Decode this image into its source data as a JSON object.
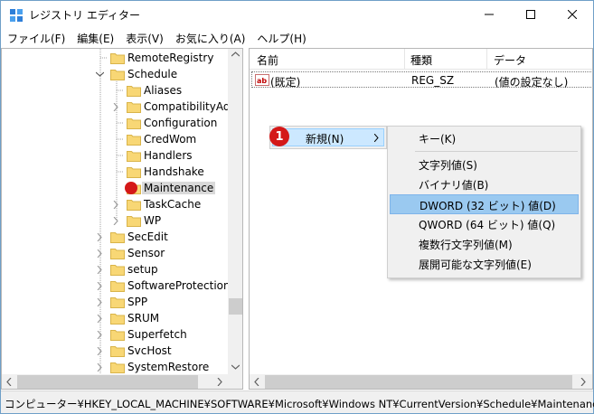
{
  "window": {
    "title": "レジストリ エディター",
    "minimize_icon": "minimize-icon",
    "maximize_icon": "maximize-icon",
    "close_icon": "close-icon"
  },
  "menubar": [
    "ファイル(F)",
    "編集(E)",
    "表示(V)",
    "お気に入り(A)",
    "ヘルプ(H)"
  ],
  "tree": {
    "items": [
      {
        "label": "RemoteRegistry",
        "expander": ""
      },
      {
        "label": "Schedule",
        "expander": "expanded"
      },
      {
        "label": "Aliases",
        "expander": ""
      },
      {
        "label": "CompatibilityAda",
        "expander": "collapsed"
      },
      {
        "label": "Configuration",
        "expander": ""
      },
      {
        "label": "CredWom",
        "expander": ""
      },
      {
        "label": "Handlers",
        "expander": ""
      },
      {
        "label": "Handshake",
        "expander": ""
      },
      {
        "label": "Maintenance",
        "expander": "",
        "selected": true
      },
      {
        "label": "TaskCache",
        "expander": "collapsed"
      },
      {
        "label": "WP",
        "expander": "collapsed"
      },
      {
        "label": "SecEdit",
        "expander": "collapsed"
      },
      {
        "label": "Sensor",
        "expander": "collapsed"
      },
      {
        "label": "setup",
        "expander": "collapsed"
      },
      {
        "label": "SoftwareProtectionPl",
        "expander": "collapsed"
      },
      {
        "label": "SPP",
        "expander": "collapsed"
      },
      {
        "label": "SRUM",
        "expander": "collapsed"
      },
      {
        "label": "Superfetch",
        "expander": "collapsed"
      },
      {
        "label": "SvcHost",
        "expander": "collapsed"
      },
      {
        "label": "SystemRestore",
        "expander": "collapsed"
      }
    ]
  },
  "list": {
    "columns": [
      "名前",
      "種類",
      "データ"
    ],
    "rows": [
      {
        "name": "(既定)",
        "type": "REG_SZ",
        "data": "(値の設定なし)",
        "icon": "string-value-icon"
      }
    ]
  },
  "context_menu": {
    "parent_label": "新規(N)",
    "step_badge": "1",
    "items": [
      "キー(K)",
      "文字列値(S)",
      "バイナリ値(B)",
      "DWORD (32 ビット) 値(D)",
      "QWORD (64 ビット) 値(Q)",
      "複数行文字列値(M)",
      "展開可能な文字列値(E)"
    ],
    "highlighted_index": 3
  },
  "status": {
    "path": "コンピューター¥HKEY_LOCAL_MACHINE¥SOFTWARE¥Microsoft¥Windows NT¥CurrentVersion¥Schedule¥Maintenance"
  },
  "colors": {
    "menu_highlight": "#9ac9f0",
    "badge": "#d41818",
    "folder": "#f8d775"
  }
}
